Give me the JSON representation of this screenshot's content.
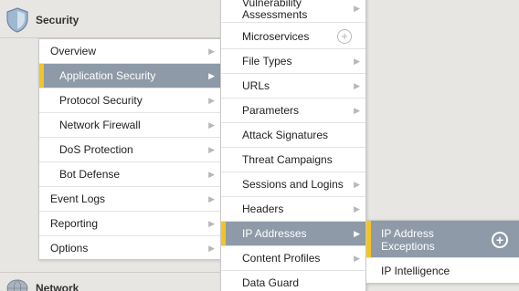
{
  "sections": {
    "security_title": "Security",
    "network_title": "Network"
  },
  "menu1": {
    "items": [
      {
        "label": "Overview"
      },
      {
        "label": "Application Security"
      },
      {
        "label": "Protocol Security"
      },
      {
        "label": "Network Firewall"
      },
      {
        "label": "DoS Protection"
      },
      {
        "label": "Bot Defense"
      },
      {
        "label": "Event Logs"
      },
      {
        "label": "Reporting"
      },
      {
        "label": "Options"
      }
    ]
  },
  "menu2": {
    "items": [
      {
        "label": "Vulnerability Assessments"
      },
      {
        "label": "Microservices"
      },
      {
        "label": "File Types"
      },
      {
        "label": "URLs"
      },
      {
        "label": "Parameters"
      },
      {
        "label": "Attack Signatures"
      },
      {
        "label": "Threat Campaigns"
      },
      {
        "label": "Sessions and Logins"
      },
      {
        "label": "Headers"
      },
      {
        "label": "IP Addresses"
      },
      {
        "label": "Content Profiles"
      },
      {
        "label": "Data Guard"
      }
    ]
  },
  "menu3": {
    "items": [
      {
        "label": "IP Address Exceptions"
      },
      {
        "label": "IP Intelligence"
      }
    ]
  },
  "colors": {
    "active_bg": "#8e9aa8",
    "active_bar": "#f2c522"
  },
  "icons": {
    "security": "shield-icon",
    "network": "globe-icon",
    "add": "plus-circle-icon",
    "submenu": "chevron-right-icon"
  }
}
